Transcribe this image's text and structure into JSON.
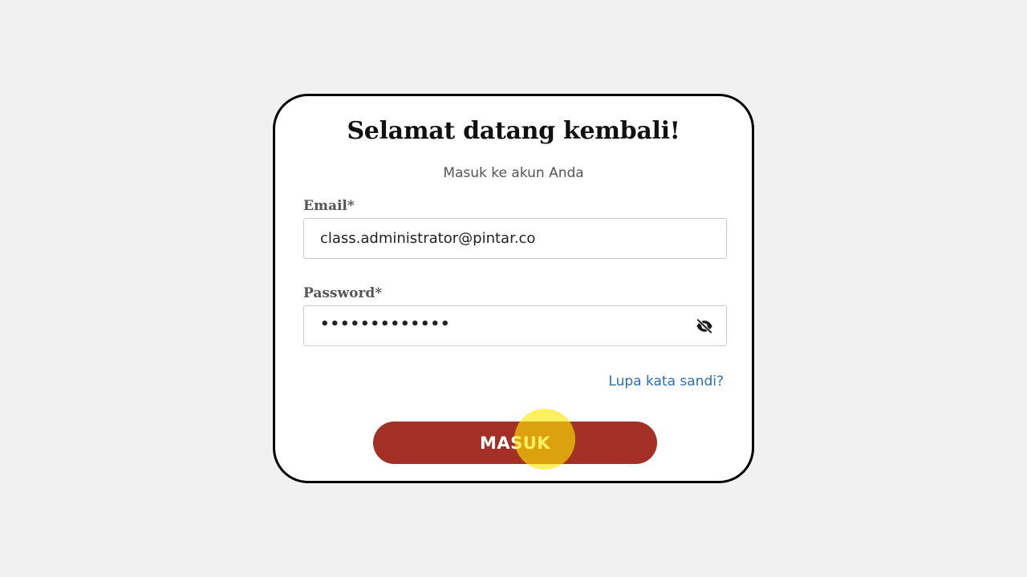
{
  "login": {
    "title": "Selamat datang kembali!",
    "subtitle": "Masuk ke akun Anda",
    "email_label": "Email*",
    "email_value": "class.administrator@pintar.co",
    "password_label": "Password*",
    "password_value": "•••••••••••••",
    "toggle_icon": "eye-off-icon",
    "forgot_link": "Lupa kata sandi?",
    "submit_label": "MASUK"
  },
  "colors": {
    "page_background": "#f1f1f1",
    "button": "#a33026",
    "link": "#2a6fb0",
    "cursor_highlight": "#ffe600"
  }
}
